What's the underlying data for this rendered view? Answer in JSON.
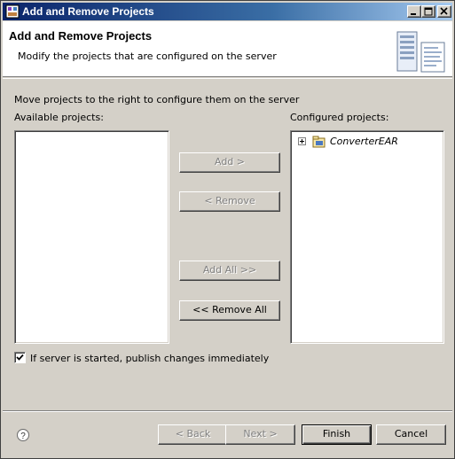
{
  "window": {
    "title": "Add and Remove Projects",
    "controls": {
      "minimize": "minimize",
      "maximize": "maximize",
      "close": "close"
    }
  },
  "banner": {
    "title": "Add and Remove Projects",
    "description": "Modify the projects that are configured on the server",
    "graphic_icon": "server-wizard-icon"
  },
  "instructions": "Move projects to the right to configure them on the server",
  "available": {
    "label": "Available projects:",
    "items": []
  },
  "configured": {
    "label": "Configured projects:",
    "items": [
      {
        "label": "ConverterEAR",
        "icon": "ear-project-icon",
        "expanded": false
      }
    ]
  },
  "buttons": {
    "add": "Add >",
    "remove": "< Remove",
    "add_all": "Add All >>",
    "remove_all": "<< Remove All"
  },
  "publish_option": {
    "label": "If server is started, publish changes immediately",
    "checked": true
  },
  "footer": {
    "help_icon": "help-icon",
    "back": "< Back",
    "next": "Next >",
    "finish": "Finish",
    "cancel": "Cancel"
  },
  "colors": {
    "titlebar_start": "#0a246a",
    "titlebar_end": "#a6caf0",
    "face": "#d4d0c8"
  }
}
